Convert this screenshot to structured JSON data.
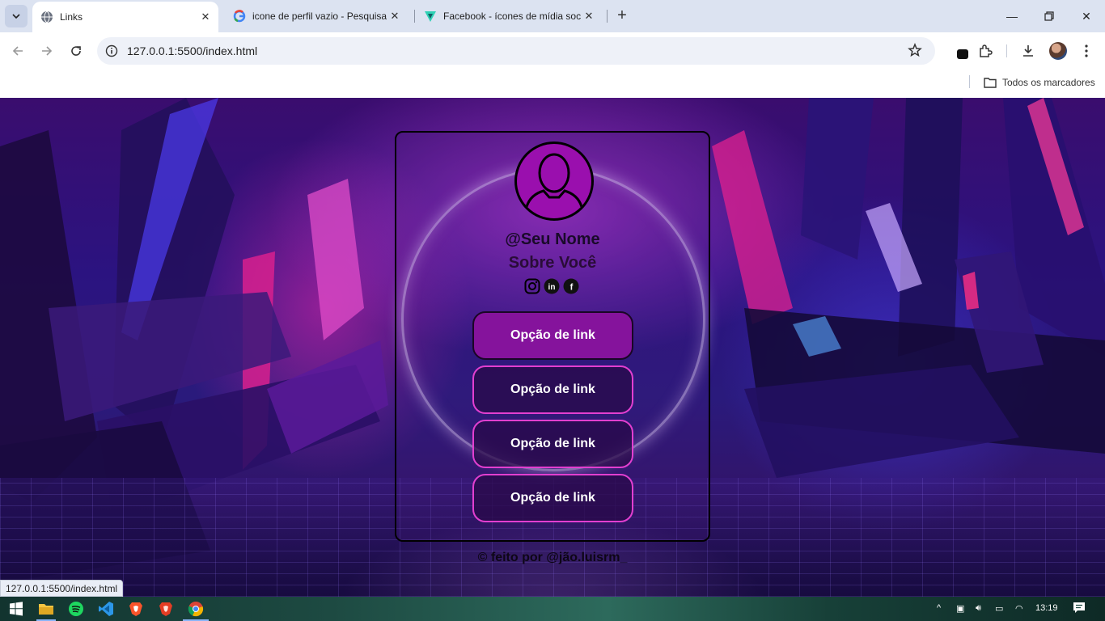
{
  "browser": {
    "tabs": [
      {
        "title": "Links",
        "active": true,
        "favicon": "globe-icon"
      },
      {
        "title": "icone de perfil vazio - Pesquisa",
        "active": false,
        "favicon": "google-icon"
      },
      {
        "title": "Facebook - ícones de mídia soc",
        "active": false,
        "favicon": "flaticon-icon"
      }
    ],
    "url": "127.0.0.1:5500/index.html",
    "bookmarks_label": "Todos os marcadores"
  },
  "page": {
    "username": "@Seu Nome",
    "about": "Sobre Você",
    "socials": [
      "instagram-icon",
      "linkedin-icon",
      "facebook-icon"
    ],
    "links": [
      {
        "label": "Opção de link"
      },
      {
        "label": "Opção de link"
      },
      {
        "label": "Opção de link"
      },
      {
        "label": "Opção de link"
      }
    ],
    "footer": "© feito por @jão.luisrm_"
  },
  "status_bar_url": "127.0.0.1:5500/index.html",
  "taskbar": {
    "apps": [
      "windows-start-icon",
      "file-explorer-icon",
      "spotify-icon",
      "vscode-icon",
      "brave-icon",
      "brave-beta-icon",
      "chrome-icon"
    ],
    "clock": "13:19"
  },
  "colors": {
    "card_border": "#000000",
    "primary_button": "#85139c",
    "button_border": "#e23fd0",
    "avatar_bg": "#9a0fae"
  }
}
